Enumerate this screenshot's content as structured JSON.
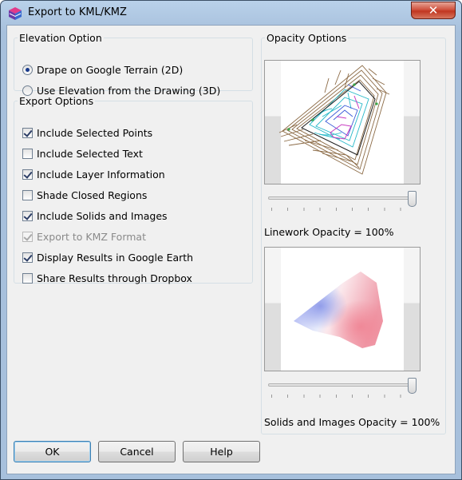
{
  "window": {
    "title": "Export to KML/KMZ",
    "close_label": "✕"
  },
  "elevation": {
    "legend": "Elevation Option",
    "options": [
      {
        "label": "Drape on Google Terrain (2D)",
        "selected": true
      },
      {
        "label": "Use Elevation from the Drawing (3D)",
        "selected": false
      }
    ]
  },
  "export": {
    "legend": "Export Options",
    "options": [
      {
        "label": "Include Selected Points",
        "checked": true,
        "enabled": true
      },
      {
        "label": "Include Selected Text",
        "checked": false,
        "enabled": true
      },
      {
        "label": "Include Layer Information",
        "checked": true,
        "enabled": true
      },
      {
        "label": "Shade Closed Regions",
        "checked": false,
        "enabled": true
      },
      {
        "label": "Include Solids and Images",
        "checked": true,
        "enabled": true
      },
      {
        "label": "Export to KMZ Format",
        "checked": true,
        "enabled": false
      },
      {
        "label": "Display Results in Google Earth",
        "checked": true,
        "enabled": true
      },
      {
        "label": "Share Results through Dropbox",
        "checked": false,
        "enabled": true
      }
    ]
  },
  "opacity": {
    "legend": "Opacity Options",
    "linework_label": "Linework Opacity = 100%",
    "linework_value": 100,
    "solids_label": "Solids and Images Opacity = 100%",
    "solids_value": 100
  },
  "buttons": {
    "ok": "OK",
    "cancel": "Cancel",
    "help": "Help"
  },
  "colors": {
    "accent": "#17398b",
    "title_bar": "#b9d1ea",
    "close": "#c13621"
  }
}
